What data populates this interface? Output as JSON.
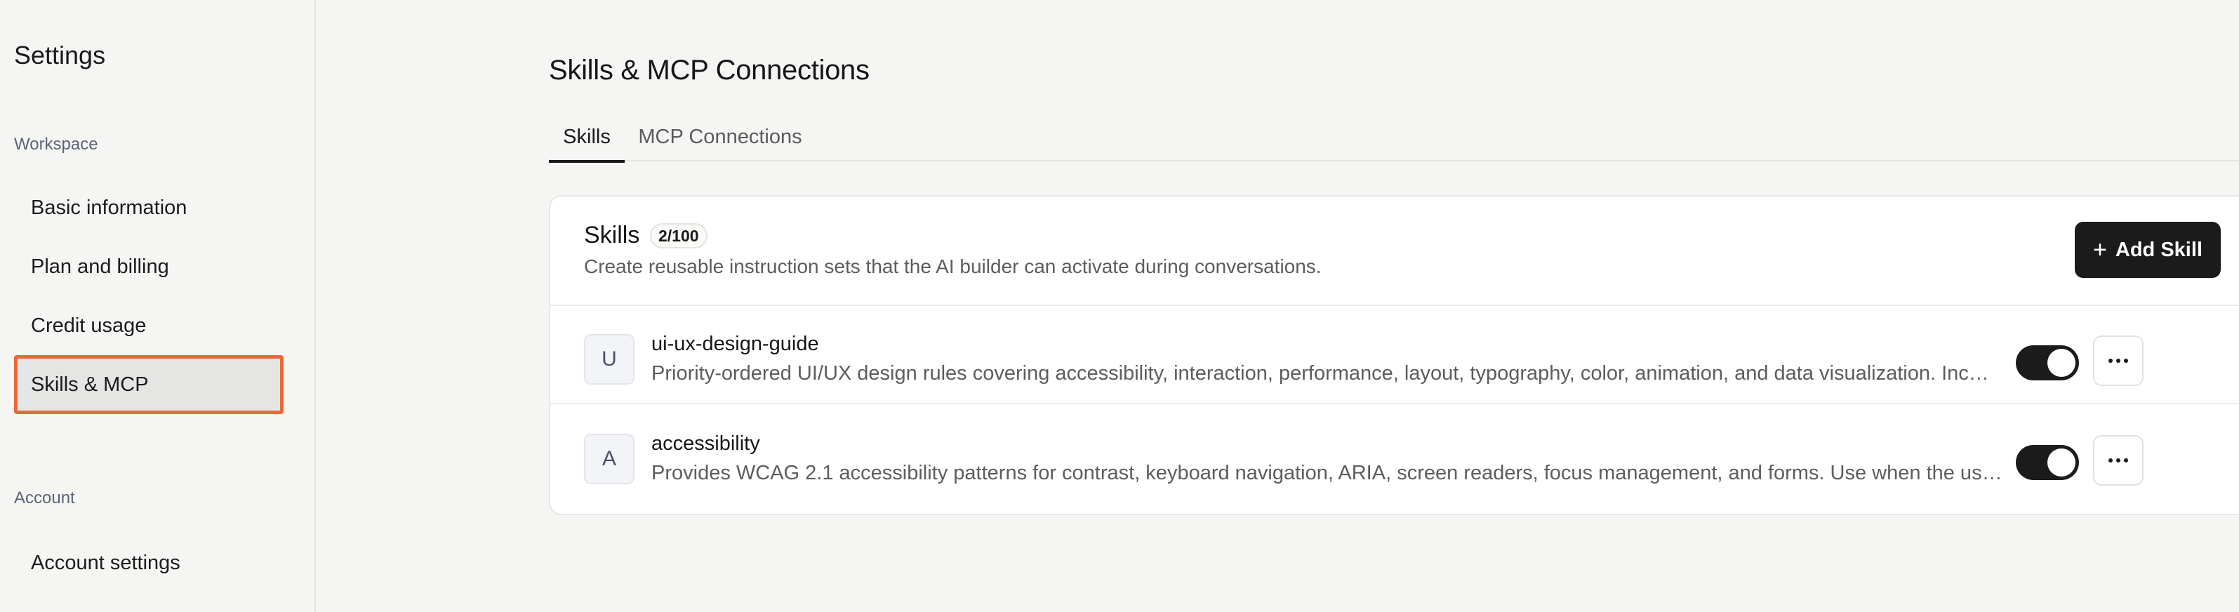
{
  "sidebar": {
    "title": "Settings",
    "workspace_label": "Workspace",
    "workspace_items": [
      {
        "label": "Basic information"
      },
      {
        "label": "Plan and billing"
      },
      {
        "label": "Credit usage"
      },
      {
        "label": "Skills & MCP",
        "active": true
      }
    ],
    "account_label": "Account",
    "account_items": [
      {
        "label": "Account settings"
      }
    ],
    "active_highlight_color": "#e8693a"
  },
  "main": {
    "title": "Skills & MCP Connections",
    "tabs": [
      {
        "label": "Skills",
        "active": true
      },
      {
        "label": "MCP Connections",
        "active": false
      }
    ],
    "skills_card": {
      "title": "Skills",
      "count": "2/100",
      "description": "Create reusable instruction sets that the AI builder can activate during conversations.",
      "add_button": {
        "label": "Add Skill",
        "icon": "plus-icon"
      },
      "skills": [
        {
          "initial": "U",
          "name": "ui-ux-design-guide",
          "description": "Priority-ordered UI/UX design rules covering accessibility, interaction, performance, layout, typography, color, animation, and data visualization. Inc…",
          "enabled": true
        },
        {
          "initial": "A",
          "name": "accessibility",
          "description": "Provides WCAG 2.1 accessibility patterns for contrast, keyboard navigation, ARIA, screen readers, focus management, and forms. Use when the us…",
          "enabled": true
        }
      ]
    }
  },
  "colors": {
    "background": "#f5f5f3",
    "card": "#ffffff",
    "primary_button": "#1b1b1b",
    "toggle_on": "#1b1b1b"
  }
}
